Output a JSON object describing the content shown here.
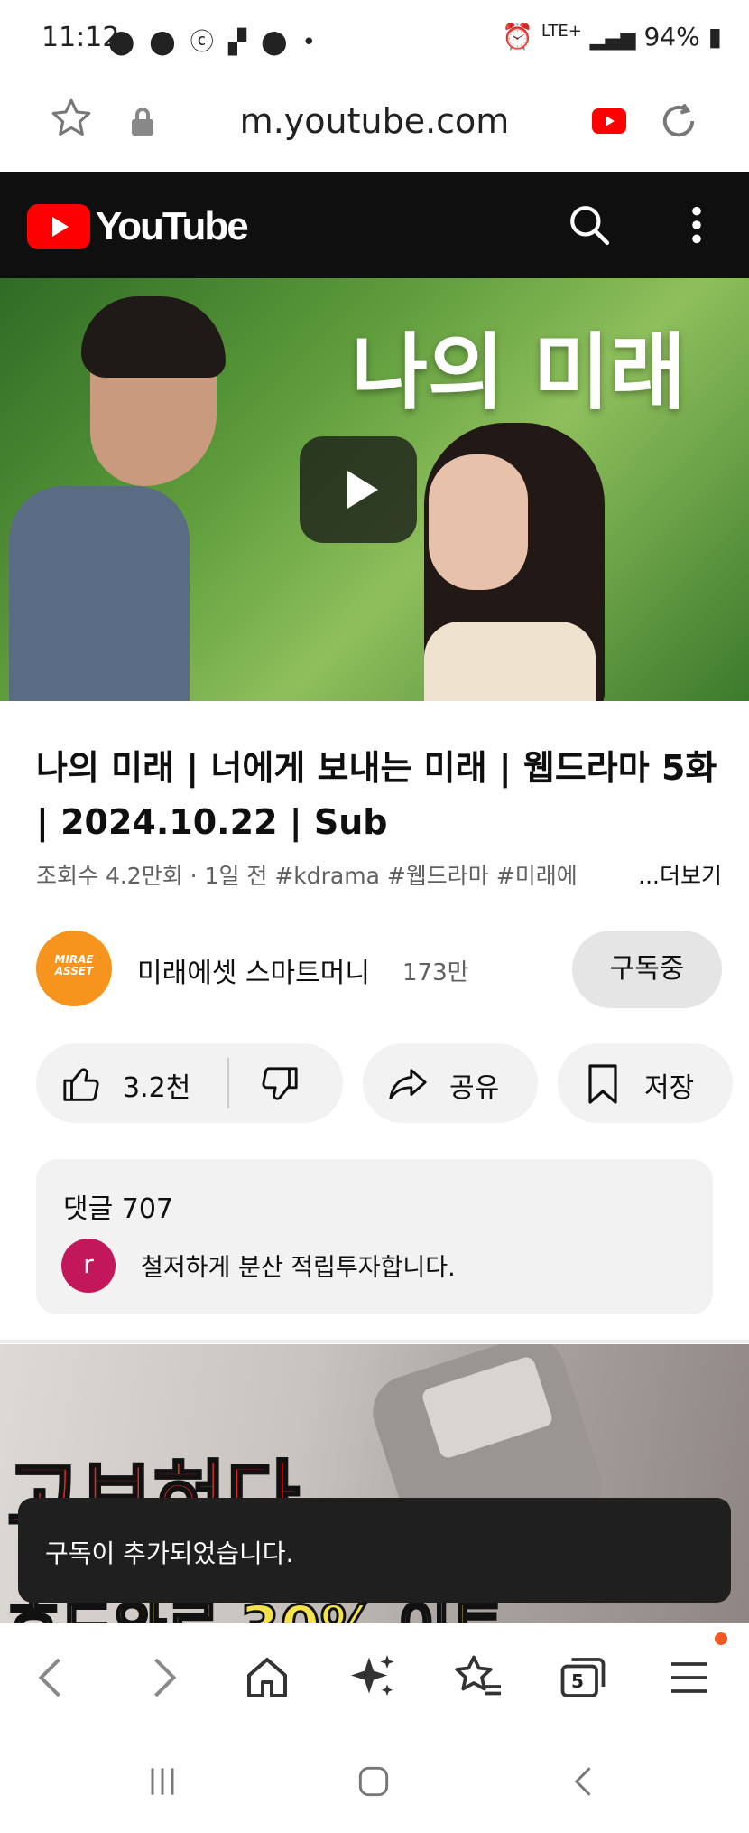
{
  "status_bar": {
    "time": "11:12",
    "battery": "94%",
    "network": "LTE+"
  },
  "address_bar": {
    "url": "m.youtube.com"
  },
  "youtube": {
    "logo_text": "YouTube",
    "colors": {
      "brand_red": "#ff0000",
      "header_bg": "#0f0f0f"
    }
  },
  "video": {
    "overlay_title": "나의 미래",
    "title": "나의 미래 | 너에게 보내는 미래 | 웹드라마 5화 | 2024.10.22 | Sub",
    "meta": "조회수 4.2만회 · 1일 전   #kdrama #웹드라마 #미래에",
    "more_label": "...더보기"
  },
  "channel": {
    "avatar_text": "MIRAE ASSET",
    "name": "미래에셋 스마트머니",
    "subscribers": "173만",
    "subscribe_label": "구독중"
  },
  "actions": {
    "like_count": "3.2천",
    "share_label": "공유",
    "save_label": "저장"
  },
  "comments": {
    "header": "댓글 707",
    "first_avatar_letter": "r",
    "first_comment": "철저하게 분산 적립투자합니다."
  },
  "next_video": {
    "overlay_line1": "고보혀다",
    "overlay_line2": "호드와르 30% 이토"
  },
  "toast": {
    "message": "구독이 추가되었습니다."
  },
  "browser_toolbar": {
    "tab_count": "5"
  }
}
